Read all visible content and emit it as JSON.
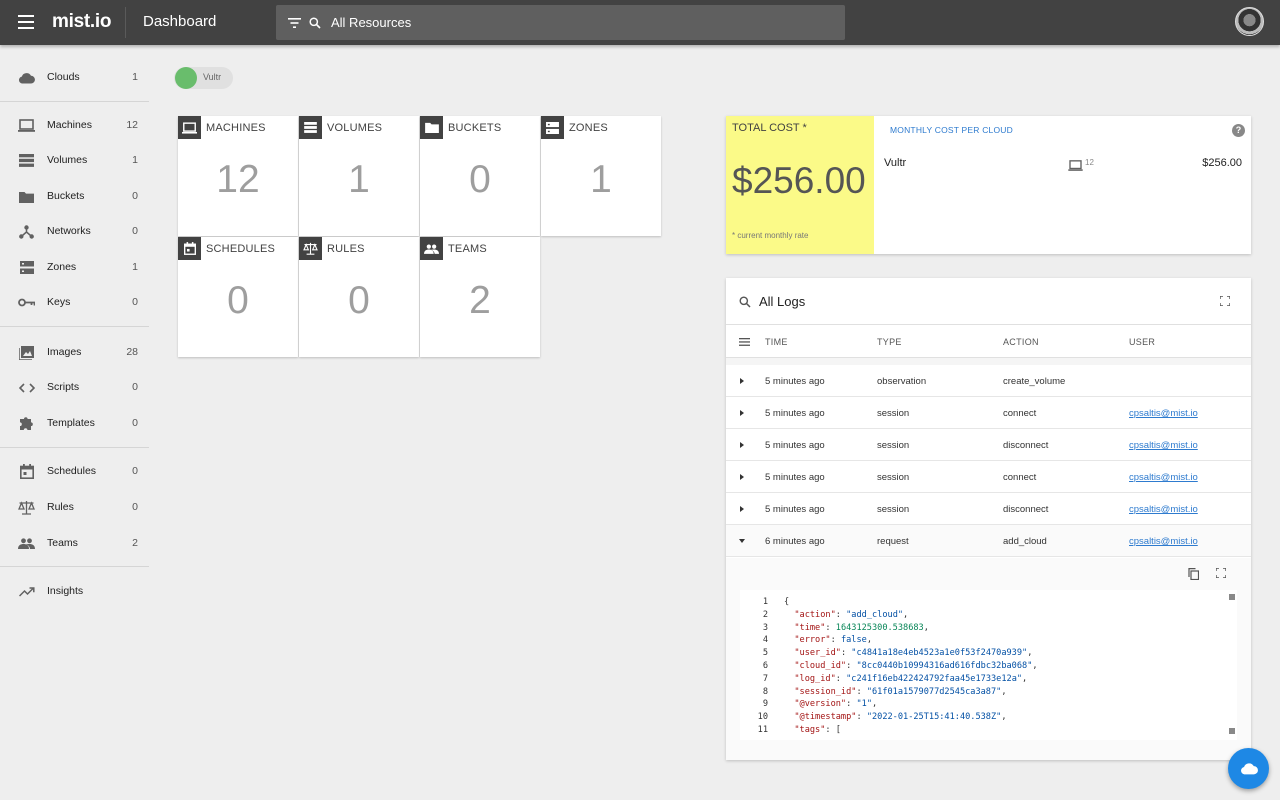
{
  "header": {
    "logo": "mist.io",
    "title": "Dashboard",
    "search_placeholder": "All Resources"
  },
  "sidebar": {
    "items": [
      {
        "label": "Clouds",
        "count": "1",
        "icon": "cloud-icon"
      },
      {
        "label": "Machines",
        "count": "12",
        "icon": "computer-icon"
      },
      {
        "label": "Volumes",
        "count": "1",
        "icon": "volumes-icon"
      },
      {
        "label": "Buckets",
        "count": "0",
        "icon": "folder-icon"
      },
      {
        "label": "Networks",
        "count": "0",
        "icon": "network-icon"
      },
      {
        "label": "Zones",
        "count": "1",
        "icon": "dns-icon"
      },
      {
        "label": "Keys",
        "count": "0",
        "icon": "key-icon"
      },
      {
        "label": "Images",
        "count": "28",
        "icon": "image-icon"
      },
      {
        "label": "Scripts",
        "count": "0",
        "icon": "code-icon"
      },
      {
        "label": "Templates",
        "count": "0",
        "icon": "puzzle-icon"
      },
      {
        "label": "Schedules",
        "count": "0",
        "icon": "calendar-icon"
      },
      {
        "label": "Rules",
        "count": "0",
        "icon": "scale-icon"
      },
      {
        "label": "Teams",
        "count": "2",
        "icon": "people-icon"
      },
      {
        "label": "Insights",
        "icon": "trending-icon"
      }
    ]
  },
  "cloud_chip": {
    "label": "Vultr",
    "color": "#69bd6c"
  },
  "tiles": [
    {
      "label": "MACHINES",
      "value": "12",
      "icon": "computer-icon"
    },
    {
      "label": "VOLUMES",
      "value": "1",
      "icon": "volumes-icon"
    },
    {
      "label": "BUCKETS",
      "value": "0",
      "icon": "folder-icon"
    },
    {
      "label": "ZONES",
      "value": "1",
      "icon": "dns-icon"
    },
    {
      "label": "SCHEDULES",
      "value": "0",
      "icon": "calendar-icon"
    },
    {
      "label": "RULES",
      "value": "0",
      "icon": "scale-icon"
    },
    {
      "label": "TEAMS",
      "value": "2",
      "icon": "people-icon"
    }
  ],
  "cost": {
    "title": "TOTAL COST *",
    "value": "$256.00",
    "note": "* current monthly rate",
    "monthly_title": "MONTHLY COST PER CLOUD",
    "help": "?",
    "cloud_name": "Vultr",
    "machine_count": "12",
    "amount": "$256.00",
    "highlight_color": "#fbfa88"
  },
  "logs": {
    "title": "All Logs",
    "columns": [
      "TIME",
      "TYPE",
      "ACTION",
      "USER"
    ],
    "rows": [
      {
        "time": "5 minutes ago",
        "type": "observation",
        "action": "create_volume",
        "user": ""
      },
      {
        "time": "5 minutes ago",
        "type": "session",
        "action": "connect",
        "user": "cpsaltis@mist.io"
      },
      {
        "time": "5 minutes ago",
        "type": "session",
        "action": "disconnect",
        "user": "cpsaltis@mist.io"
      },
      {
        "time": "5 minutes ago",
        "type": "session",
        "action": "connect",
        "user": "cpsaltis@mist.io"
      },
      {
        "time": "5 minutes ago",
        "type": "session",
        "action": "disconnect",
        "user": "cpsaltis@mist.io"
      },
      {
        "time": "6 minutes ago",
        "type": "request",
        "action": "add_cloud",
        "user": "cpsaltis@mist.io",
        "expanded": true
      }
    ],
    "json_lines": [
      {
        "n": "1",
        "t": [
          [
            "p",
            "{"
          ]
        ]
      },
      {
        "n": "2",
        "t": [
          [
            "p",
            "  "
          ],
          [
            "k",
            "\"action\""
          ],
          [
            "p",
            ": "
          ],
          [
            "s",
            "\"add_cloud\""
          ],
          [
            "p",
            ","
          ]
        ]
      },
      {
        "n": "3",
        "t": [
          [
            "p",
            "  "
          ],
          [
            "k",
            "\"time\""
          ],
          [
            "p",
            ": "
          ],
          [
            "n",
            "1643125300.538683"
          ],
          [
            "p",
            ","
          ]
        ]
      },
      {
        "n": "4",
        "t": [
          [
            "p",
            "  "
          ],
          [
            "k",
            "\"error\""
          ],
          [
            "p",
            ": "
          ],
          [
            "s",
            "false"
          ],
          [
            "p",
            ","
          ]
        ]
      },
      {
        "n": "5",
        "t": [
          [
            "p",
            "  "
          ],
          [
            "k",
            "\"user_id\""
          ],
          [
            "p",
            ": "
          ],
          [
            "s",
            "\"c4841a18e4eb4523a1e0f53f2470a939\""
          ],
          [
            "p",
            ","
          ]
        ]
      },
      {
        "n": "6",
        "t": [
          [
            "p",
            "  "
          ],
          [
            "k",
            "\"cloud_id\""
          ],
          [
            "p",
            ": "
          ],
          [
            "s",
            "\"8cc0440b10994316ad616fdbc32ba068\""
          ],
          [
            "p",
            ","
          ]
        ]
      },
      {
        "n": "7",
        "t": [
          [
            "p",
            "  "
          ],
          [
            "k",
            "\"log_id\""
          ],
          [
            "p",
            ": "
          ],
          [
            "s",
            "\"c241f16eb422424792faa45e1733e12a\""
          ],
          [
            "p",
            ","
          ]
        ]
      },
      {
        "n": "8",
        "t": [
          [
            "p",
            "  "
          ],
          [
            "k",
            "\"session_id\""
          ],
          [
            "p",
            ": "
          ],
          [
            "s",
            "\"61f01a1579077d2545ca3a87\""
          ],
          [
            "p",
            ","
          ]
        ]
      },
      {
        "n": "9",
        "t": [
          [
            "p",
            "  "
          ],
          [
            "k",
            "\"@version\""
          ],
          [
            "p",
            ": "
          ],
          [
            "s",
            "\"1\""
          ],
          [
            "p",
            ","
          ]
        ]
      },
      {
        "n": "10",
        "t": [
          [
            "p",
            "  "
          ],
          [
            "k",
            "\"@timestamp\""
          ],
          [
            "p",
            ": "
          ],
          [
            "s",
            "\"2022-01-25T15:41:40.538Z\""
          ],
          [
            "p",
            ","
          ]
        ]
      },
      {
        "n": "11",
        "t": [
          [
            "p",
            "  "
          ],
          [
            "k",
            "\"tags\""
          ],
          [
            "p",
            ": ["
          ]
        ]
      }
    ]
  },
  "colors": {
    "header": "#424242",
    "accent": "#1e88e5",
    "link": "#2e7bcf"
  }
}
